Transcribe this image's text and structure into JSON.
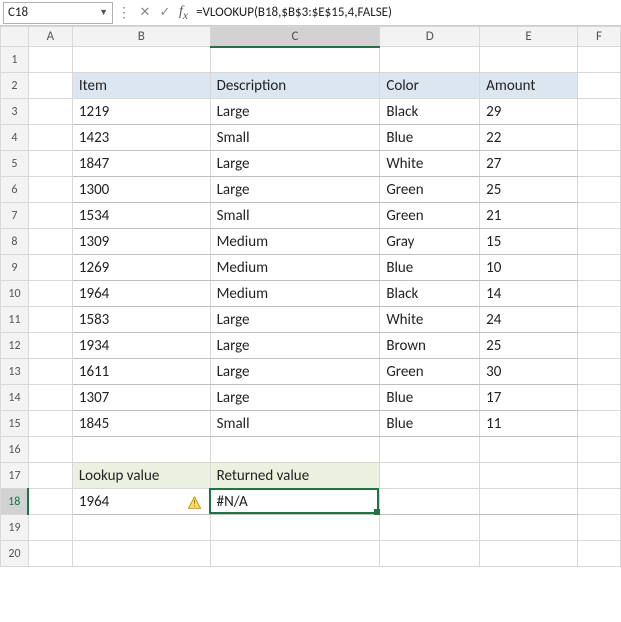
{
  "name_box": "C18",
  "formula": "=VLOOKUP(B18,$B$3:$E$15,4,FALSE)",
  "columns": [
    "A",
    "B",
    "C",
    "D",
    "E",
    "F"
  ],
  "active_col": "C",
  "active_row": "18",
  "headers": {
    "item": "Item",
    "desc": "Description",
    "color": "Color",
    "amount": "Amount"
  },
  "rows": [
    {
      "item": "1219",
      "desc": "Large",
      "color": "Black",
      "amount": "29"
    },
    {
      "item": "1423",
      "desc": "Small",
      "color": "Blue",
      "amount": "22"
    },
    {
      "item": "1847",
      "desc": "Large",
      "color": "White",
      "amount": "27"
    },
    {
      "item": "1300",
      "desc": "Large",
      "color": "Green",
      "amount": "25"
    },
    {
      "item": "1534",
      "desc": "Small",
      "color": "Green",
      "amount": "21"
    },
    {
      "item": "1309",
      "desc": "Medium",
      "color": "Gray",
      "amount": "15"
    },
    {
      "item": "1269",
      "desc": "Medium",
      "color": "Blue",
      "amount": "10"
    },
    {
      "item": "1964",
      "desc": "Medium",
      "color": "Black",
      "amount": "14"
    },
    {
      "item": "1583",
      "desc": "Large",
      "color": "White",
      "amount": "24"
    },
    {
      "item": "1934",
      "desc": "Large",
      "color": "Brown",
      "amount": "25"
    },
    {
      "item": "1611",
      "desc": "Large",
      "color": "Green",
      "amount": "30"
    },
    {
      "item": "1307",
      "desc": "Large",
      "color": "Blue",
      "amount": "17"
    },
    {
      "item": "1845",
      "desc": "Small",
      "color": "Blue",
      "amount": "11"
    }
  ],
  "lookup_header": {
    "b": "Lookup value",
    "c": "Returned value"
  },
  "lookup_row": {
    "value": "1964",
    "returned": "#N/A"
  },
  "chart_data": {
    "type": "table",
    "title": "VLOOKUP example",
    "columns": [
      "Item",
      "Description",
      "Color",
      "Amount"
    ],
    "data": [
      [
        1219,
        "Large",
        "Black",
        29
      ],
      [
        1423,
        "Small",
        "Blue",
        22
      ],
      [
        1847,
        "Large",
        "White",
        27
      ],
      [
        1300,
        "Large",
        "Green",
        25
      ],
      [
        1534,
        "Small",
        "Green",
        21
      ],
      [
        1309,
        "Medium",
        "Gray",
        15
      ],
      [
        1269,
        "Medium",
        "Blue",
        10
      ],
      [
        1964,
        "Medium",
        "Black",
        14
      ],
      [
        1583,
        "Large",
        "White",
        24
      ],
      [
        1934,
        "Large",
        "Brown",
        25
      ],
      [
        1611,
        "Large",
        "Green",
        30
      ],
      [
        1307,
        "Large",
        "Blue",
        17
      ],
      [
        1845,
        "Small",
        "Blue",
        11
      ]
    ],
    "lookup_value": 1964,
    "returned_value": "#N/A",
    "formula": "=VLOOKUP(B18,$B$3:$E$15,4,FALSE)"
  }
}
